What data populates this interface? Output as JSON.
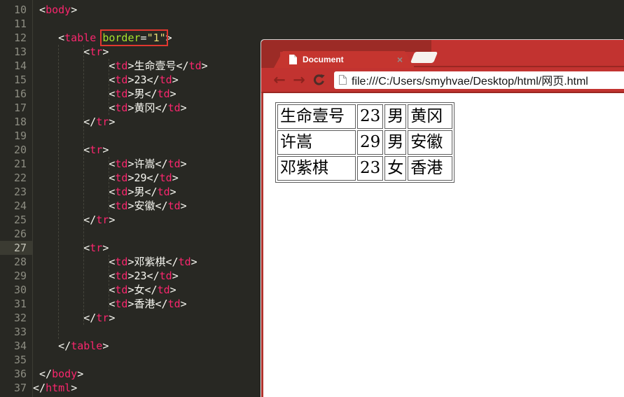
{
  "colors": {
    "editor_bg": "#282823",
    "tag_pink": "#f92672",
    "attr_green": "#a6e22e",
    "value_yellow": "#e6db74",
    "annotation_red": "#e1372f",
    "chrome_red": "#c23330",
    "frame_dark_red": "#9c2b26"
  },
  "editor": {
    "current_line": 27,
    "lines": [
      {
        "n": 10,
        "t": [
          [
            " <",
            0
          ],
          [
            "body",
            1
          ],
          [
            ">",
            0
          ]
        ]
      },
      {
        "n": 11,
        "t": []
      },
      {
        "n": 12,
        "t": [
          [
            "    <",
            0
          ],
          [
            "table",
            1
          ],
          [
            " ",
            0
          ],
          {
            "b": [
              [
                "border",
                2
              ],
              [
                "=",
                0
              ],
              [
                "\"1\"",
                3
              ]
            ]
          },
          [
            ">",
            0
          ]
        ]
      },
      {
        "n": 13,
        "t": [
          [
            "        <",
            0
          ],
          [
            "tr",
            1
          ],
          [
            ">",
            0
          ]
        ]
      },
      {
        "n": 14,
        "t": [
          [
            "            <",
            0
          ],
          [
            "td",
            1
          ],
          [
            ">生命壹号</",
            0
          ],
          [
            "td",
            1
          ],
          [
            ">",
            0
          ]
        ]
      },
      {
        "n": 15,
        "t": [
          [
            "            <",
            0
          ],
          [
            "td",
            1
          ],
          [
            ">23</",
            0
          ],
          [
            "td",
            1
          ],
          [
            ">",
            0
          ]
        ]
      },
      {
        "n": 16,
        "t": [
          [
            "            <",
            0
          ],
          [
            "td",
            1
          ],
          [
            ">男</",
            0
          ],
          [
            "td",
            1
          ],
          [
            ">",
            0
          ]
        ]
      },
      {
        "n": 17,
        "t": [
          [
            "            <",
            0
          ],
          [
            "td",
            1
          ],
          [
            ">黄冈</",
            0
          ],
          [
            "td",
            1
          ],
          [
            ">",
            0
          ]
        ]
      },
      {
        "n": 18,
        "t": [
          [
            "        </",
            0
          ],
          [
            "tr",
            1
          ],
          [
            ">",
            0
          ]
        ]
      },
      {
        "n": 19,
        "t": []
      },
      {
        "n": 20,
        "t": [
          [
            "        <",
            0
          ],
          [
            "tr",
            1
          ],
          [
            ">",
            0
          ]
        ]
      },
      {
        "n": 21,
        "t": [
          [
            "            <",
            0
          ],
          [
            "td",
            1
          ],
          [
            ">许嵩</",
            0
          ],
          [
            "td",
            1
          ],
          [
            ">",
            0
          ]
        ]
      },
      {
        "n": 22,
        "t": [
          [
            "            <",
            0
          ],
          [
            "td",
            1
          ],
          [
            ">29</",
            0
          ],
          [
            "td",
            1
          ],
          [
            ">",
            0
          ]
        ]
      },
      {
        "n": 23,
        "t": [
          [
            "            <",
            0
          ],
          [
            "td",
            1
          ],
          [
            ">男</",
            0
          ],
          [
            "td",
            1
          ],
          [
            ">",
            0
          ]
        ]
      },
      {
        "n": 24,
        "t": [
          [
            "            <",
            0
          ],
          [
            "td",
            1
          ],
          [
            ">安徽</",
            0
          ],
          [
            "td",
            1
          ],
          [
            ">",
            0
          ]
        ]
      },
      {
        "n": 25,
        "t": [
          [
            "        </",
            0
          ],
          [
            "tr",
            1
          ],
          [
            ">",
            0
          ]
        ]
      },
      {
        "n": 26,
        "t": []
      },
      {
        "n": 27,
        "t": [
          [
            "        <",
            0
          ],
          [
            "tr",
            1
          ],
          [
            ">",
            0
          ]
        ]
      },
      {
        "n": 28,
        "t": [
          [
            "            <",
            0
          ],
          [
            "td",
            1
          ],
          [
            ">邓紫棋</",
            0
          ],
          [
            "td",
            1
          ],
          [
            ">",
            0
          ]
        ]
      },
      {
        "n": 29,
        "t": [
          [
            "            <",
            0
          ],
          [
            "td",
            1
          ],
          [
            ">23</",
            0
          ],
          [
            "td",
            1
          ],
          [
            ">",
            0
          ]
        ]
      },
      {
        "n": 30,
        "t": [
          [
            "            <",
            0
          ],
          [
            "td",
            1
          ],
          [
            ">女</",
            0
          ],
          [
            "td",
            1
          ],
          [
            ">",
            0
          ]
        ]
      },
      {
        "n": 31,
        "t": [
          [
            "            <",
            0
          ],
          [
            "td",
            1
          ],
          [
            ">香港</",
            0
          ],
          [
            "td",
            1
          ],
          [
            ">",
            0
          ]
        ]
      },
      {
        "n": 32,
        "t": [
          [
            "        </",
            0
          ],
          [
            "tr",
            1
          ],
          [
            ">",
            0
          ]
        ]
      },
      {
        "n": 33,
        "t": []
      },
      {
        "n": 34,
        "t": [
          [
            "    </",
            0
          ],
          [
            "table",
            1
          ],
          [
            ">",
            0
          ]
        ]
      },
      {
        "n": 35,
        "t": []
      },
      {
        "n": 36,
        "t": [
          [
            " </",
            0
          ],
          [
            "body",
            1
          ],
          [
            ">",
            0
          ]
        ]
      },
      {
        "n": 37,
        "t": [
          [
            "</",
            0
          ],
          [
            "html",
            1
          ],
          [
            ">",
            0
          ]
        ]
      }
    ]
  },
  "browser": {
    "tab": {
      "title": "Document",
      "close_glyph": "×"
    },
    "nav": {
      "back_glyph": "←",
      "forward_glyph": "→"
    },
    "url": "file:///C:/Users/smyhvae/Desktop/html/网页.html",
    "page_table": {
      "rows": [
        [
          "生命壹号",
          "23",
          "男",
          "黄冈"
        ],
        [
          "许嵩",
          "29",
          "男",
          "安徽"
        ],
        [
          "邓紫棋",
          "23",
          "女",
          "香港"
        ]
      ]
    }
  }
}
